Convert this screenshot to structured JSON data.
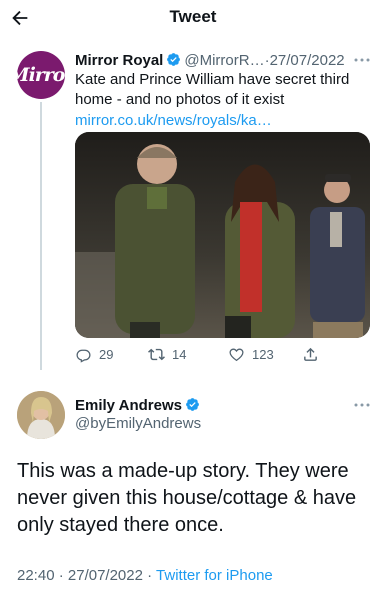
{
  "header": {
    "title": "Tweet"
  },
  "quoted_tweet": {
    "avatar_text": "Mirror",
    "name": "Mirror Royal",
    "handle": "@MirrorR…",
    "separator": "·",
    "date": "27/07/2022",
    "text": "Kate and Prince William have secret third home - and no photos of it exist",
    "link": "mirror.co.uk/news/royals/ka…",
    "stats": {
      "replies": "29",
      "retweets": "14",
      "likes": "123"
    }
  },
  "tweet": {
    "name": "Emily Andrews",
    "handle": "@byEmilyAndrews",
    "text": "This was a made-up story. They were never given this house/cottage & have only stayed there once.",
    "time": "22:40",
    "separator1": "·",
    "date": "27/07/2022",
    "separator2": "·",
    "source": "Twitter for iPhone"
  },
  "colors": {
    "accent": "#1d9bf0",
    "secondary_text": "#536471",
    "mirror_brand": "#7b1a6e"
  },
  "icons": [
    "back-arrow-icon",
    "verified-badge-icon",
    "more-icon",
    "reply-icon",
    "retweet-icon",
    "like-icon",
    "share-icon"
  ]
}
